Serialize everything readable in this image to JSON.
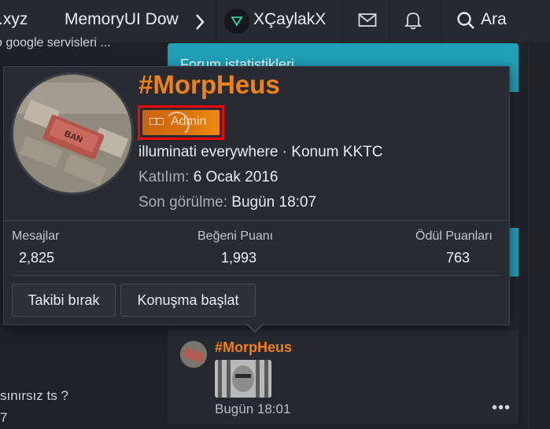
{
  "nav": {
    "item_partial": ".xyz",
    "item_memoryui": "MemoryUI Dow",
    "username": "XÇaylakX",
    "search_label": "Ara"
  },
  "background": {
    "line1": "o google servisleri ...",
    "line2": "sınırsız ts ?",
    "line3": "7"
  },
  "stats_panel": {
    "title": "Forum istatistikleri"
  },
  "post": {
    "author": "#MorpHeus",
    "time": "Bugün 18:01",
    "more": "•••"
  },
  "profile": {
    "name": "#MorpHeus",
    "banner_glyph": "□□",
    "banner_label": "Admin",
    "tagline": "illuminati everywhere · Konum KKTC",
    "joined_label": "Katılım:",
    "joined_value": "6 Ocak 2016",
    "last_seen_label": "Son görülme:",
    "last_seen_value": "Bugün 18:07",
    "stats": [
      {
        "label": "Mesajlar",
        "value": "2,825"
      },
      {
        "label": "Beğeni Puanı",
        "value": "1,993"
      },
      {
        "label": "Ödül Puanları",
        "value": "763"
      }
    ],
    "buttons": {
      "unfollow": "Takibi bırak",
      "conversation": "Konuşma başlat"
    }
  },
  "colors": {
    "accent_orange": "#f2820f",
    "teal": "#1fa0b6",
    "highlight_red": "#ff0000"
  },
  "icons": [
    "chevron-right-icon",
    "user-logo-icon",
    "envelope-icon",
    "bell-icon",
    "search-icon",
    "ellipsis-icon"
  ]
}
